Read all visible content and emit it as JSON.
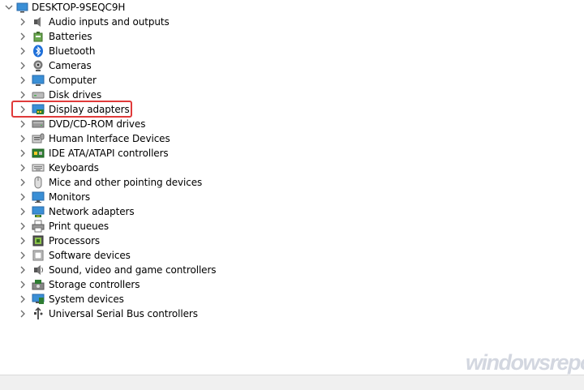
{
  "tree": {
    "root": {
      "label": "DESKTOP-9SEQC9H",
      "expanded": true
    },
    "items": [
      {
        "label": "Audio inputs and outputs",
        "icon": "speaker-icon"
      },
      {
        "label": "Batteries",
        "icon": "battery-icon"
      },
      {
        "label": "Bluetooth",
        "icon": "bluetooth-icon"
      },
      {
        "label": "Cameras",
        "icon": "camera-icon"
      },
      {
        "label": "Computer",
        "icon": "computer-icon"
      },
      {
        "label": "Disk drives",
        "icon": "disk-drive-icon"
      },
      {
        "label": "Display adapters",
        "icon": "display-adapter-icon",
        "highlighted": true
      },
      {
        "label": "DVD/CD-ROM drives",
        "icon": "dvd-drive-icon"
      },
      {
        "label": "Human Interface Devices",
        "icon": "hid-icon"
      },
      {
        "label": "IDE ATA/ATAPI controllers",
        "icon": "ide-controller-icon"
      },
      {
        "label": "Keyboards",
        "icon": "keyboard-icon"
      },
      {
        "label": "Mice and other pointing devices",
        "icon": "mouse-icon"
      },
      {
        "label": "Monitors",
        "icon": "monitor-icon"
      },
      {
        "label": "Network adapters",
        "icon": "network-adapter-icon"
      },
      {
        "label": "Print queues",
        "icon": "printer-icon"
      },
      {
        "label": "Processors",
        "icon": "processor-icon"
      },
      {
        "label": "Software devices",
        "icon": "software-device-icon"
      },
      {
        "label": "Sound, video and game controllers",
        "icon": "sound-controller-icon"
      },
      {
        "label": "Storage controllers",
        "icon": "storage-controller-icon"
      },
      {
        "label": "System devices",
        "icon": "system-device-icon"
      },
      {
        "label": "Universal Serial Bus controllers",
        "icon": "usb-icon"
      }
    ]
  },
  "watermark": "windowsreport",
  "colors": {
    "highlight": "#e03a3a",
    "chevron": "#6a6a6a"
  }
}
